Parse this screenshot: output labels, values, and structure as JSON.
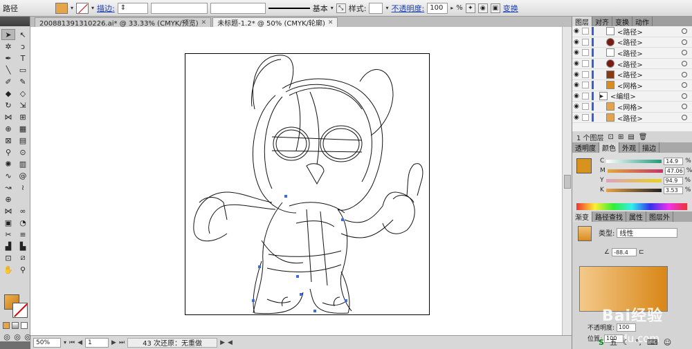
{
  "control_bar": {
    "path_label": "路径",
    "stroke_label": "描边:",
    "basic_label": "基本",
    "style_label": "样式:",
    "opacity_label": "不透明度:",
    "opacity_value": "100",
    "opacity_unit": "%",
    "transform_label": "变换",
    "fill_color": "#e7a54a"
  },
  "tabs": [
    {
      "label": "200881391310226.ai* @ 33.33% (CMYK/预览)"
    },
    {
      "label": "未标题-1.2* @ 50% (CMYK/轮廓)"
    }
  ],
  "layers_panel": {
    "tabs": [
      "图层",
      "对齐",
      "变换",
      "动作"
    ],
    "rows": [
      {
        "name": "<路径>"
      },
      {
        "name": "<路径>"
      },
      {
        "name": "<路径>"
      },
      {
        "name": "<路径>"
      },
      {
        "name": "<路径>"
      },
      {
        "name": "<网格>"
      },
      {
        "name": "<编组>"
      },
      {
        "name": "<网格>"
      },
      {
        "name": "<路径>"
      }
    ],
    "footer": "1 个图层"
  },
  "color_panel": {
    "tabs": [
      "透明度",
      "颜色",
      "外观",
      "描边"
    ],
    "rows": [
      {
        "label": "C",
        "value": "14.9",
        "color": "#1d9a7c"
      },
      {
        "label": "M",
        "value": "47.06",
        "color": "#c4326a"
      },
      {
        "label": "Y",
        "value": "94.9",
        "color": "#e7d21a"
      },
      {
        "label": "K",
        "value": "3.53",
        "color": "#222222"
      }
    ],
    "unit": "%"
  },
  "gradient_panel": {
    "tabs": [
      "渐变",
      "路径查找",
      "属性",
      "图层外"
    ],
    "type_label": "类型:",
    "type_value": "线性",
    "angle_value": "-88.4",
    "opacity_label": "不透明度:",
    "opacity_value": "100",
    "position_label": "位置:",
    "position_value": "100"
  },
  "status": {
    "zoom": "50%",
    "page": "1",
    "info": "43 次还原：无重做"
  },
  "watermark": {
    "text": "Bai经验",
    "url": "h.baidu.com"
  },
  "taskbar": {
    "ime": "S",
    "ime_label": "五"
  }
}
